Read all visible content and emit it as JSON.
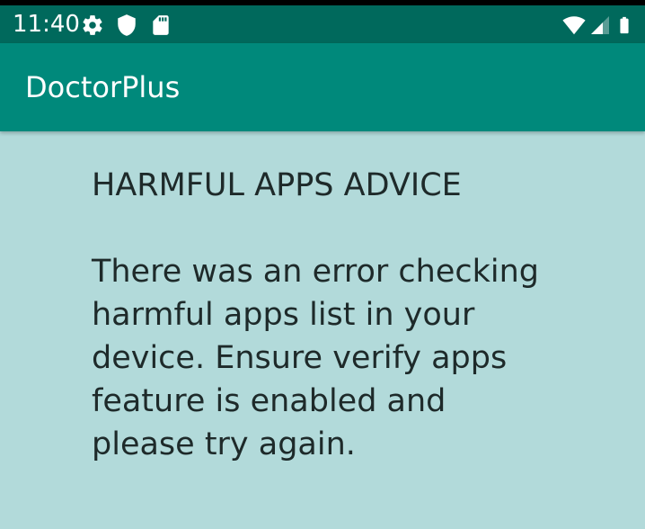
{
  "status_bar": {
    "time": "11:40",
    "icons": [
      "gear-icon",
      "shield-icon",
      "sd-card-icon",
      "wifi-icon",
      "cell-signal-icon",
      "battery-icon"
    ],
    "background": "#00695c"
  },
  "app_bar": {
    "title": "DoctorPlus",
    "background": "#00897b"
  },
  "content": {
    "heading": "HARMFUL APPS ADVICE",
    "message": "There was an error checking harmful apps list in your device. Ensure verify apps feature is enabled and please try again.",
    "background": "#b2dada"
  }
}
